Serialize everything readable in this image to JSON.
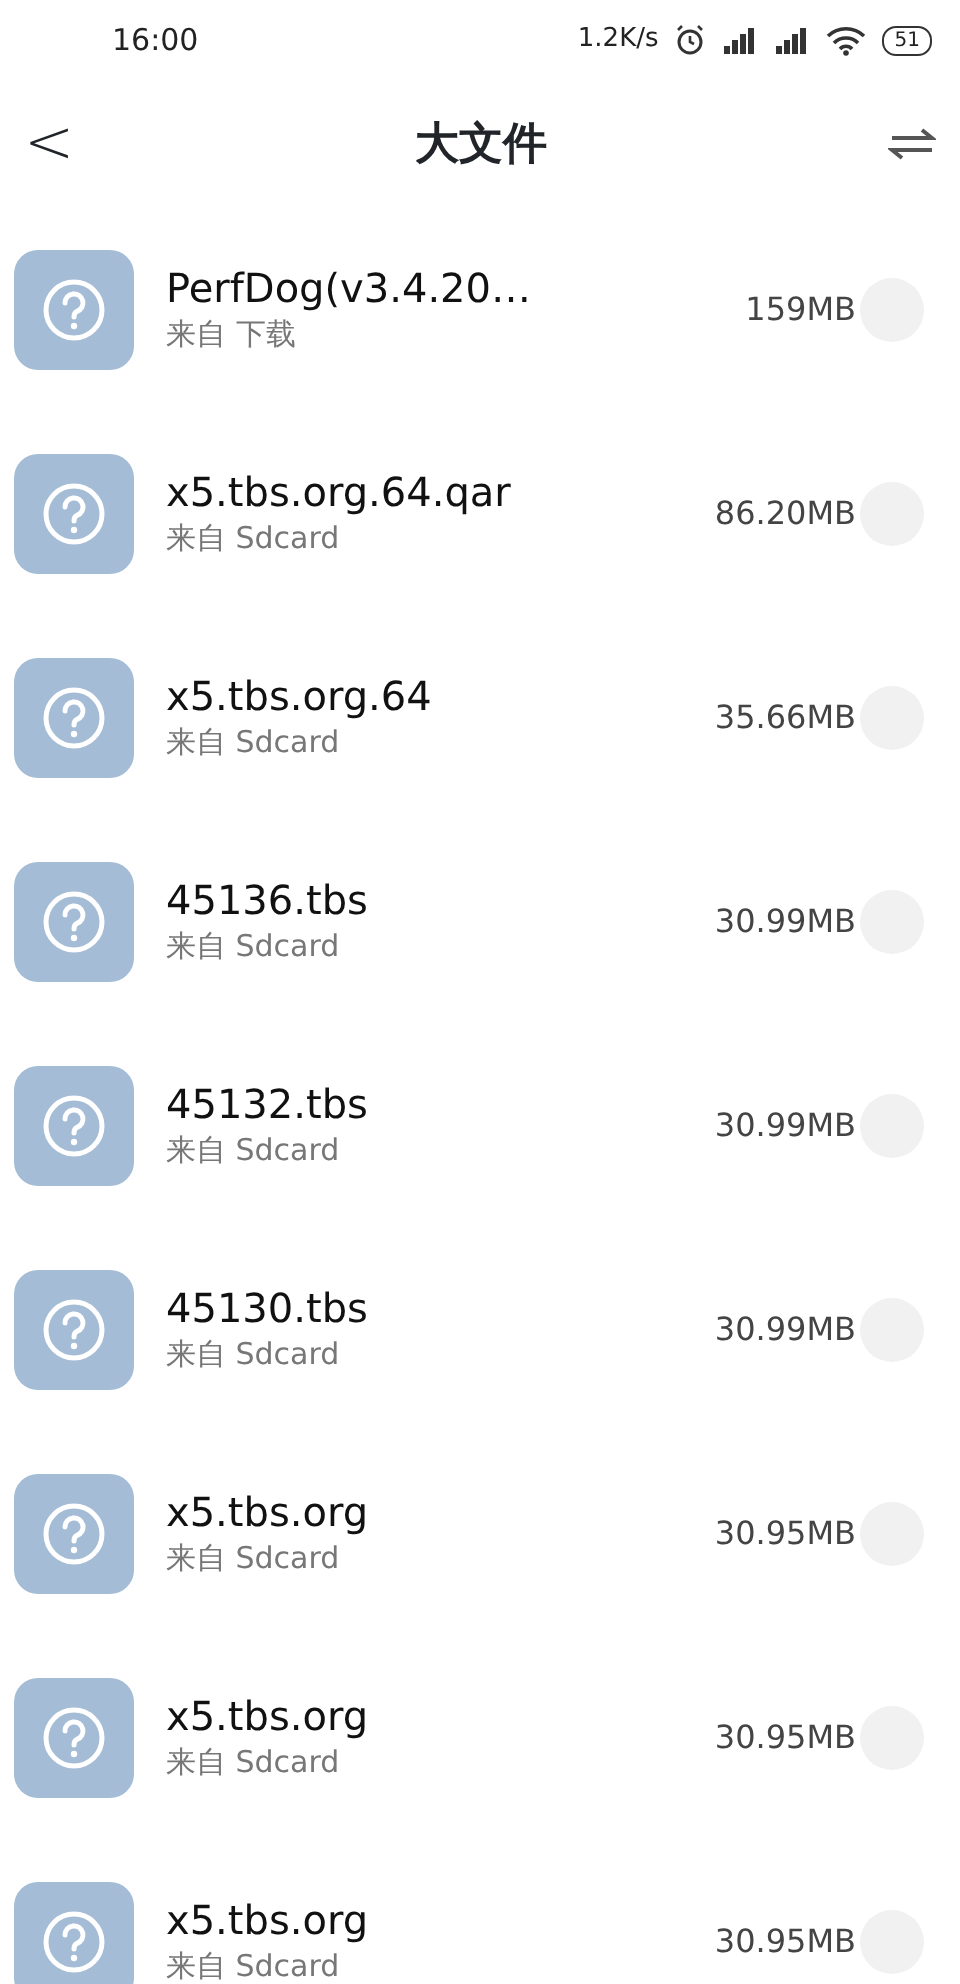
{
  "status_bar": {
    "time": "16:00",
    "speed": "1.2K/s",
    "battery": "51"
  },
  "header": {
    "back": "<",
    "title": "大文件"
  },
  "files": [
    {
      "name": "PerfDog(v3.4.20…",
      "source": "来自 下载",
      "size": "159MB",
      "checked": false
    },
    {
      "name": "x5.tbs.org.64.qar",
      "source": "来自 Sdcard",
      "size": "86.20MB",
      "checked": false
    },
    {
      "name": "x5.tbs.org.64",
      "source": "来自 Sdcard",
      "size": "35.66MB",
      "checked": false
    },
    {
      "name": "45136.tbs",
      "source": "来自 Sdcard",
      "size": "30.99MB",
      "checked": false
    },
    {
      "name": "45132.tbs",
      "source": "来自 Sdcard",
      "size": "30.99MB",
      "checked": false
    },
    {
      "name": "45130.tbs",
      "source": "来自 Sdcard",
      "size": "30.99MB",
      "checked": false
    },
    {
      "name": "x5.tbs.org",
      "source": "来自 Sdcard",
      "size": "30.95MB",
      "checked": false
    },
    {
      "name": "x5.tbs.org",
      "source": "来自 Sdcard",
      "size": "30.95MB",
      "checked": false
    },
    {
      "name": "x5.tbs.org",
      "source": "来自 Sdcard",
      "size": "30.95MB",
      "checked": false
    }
  ]
}
